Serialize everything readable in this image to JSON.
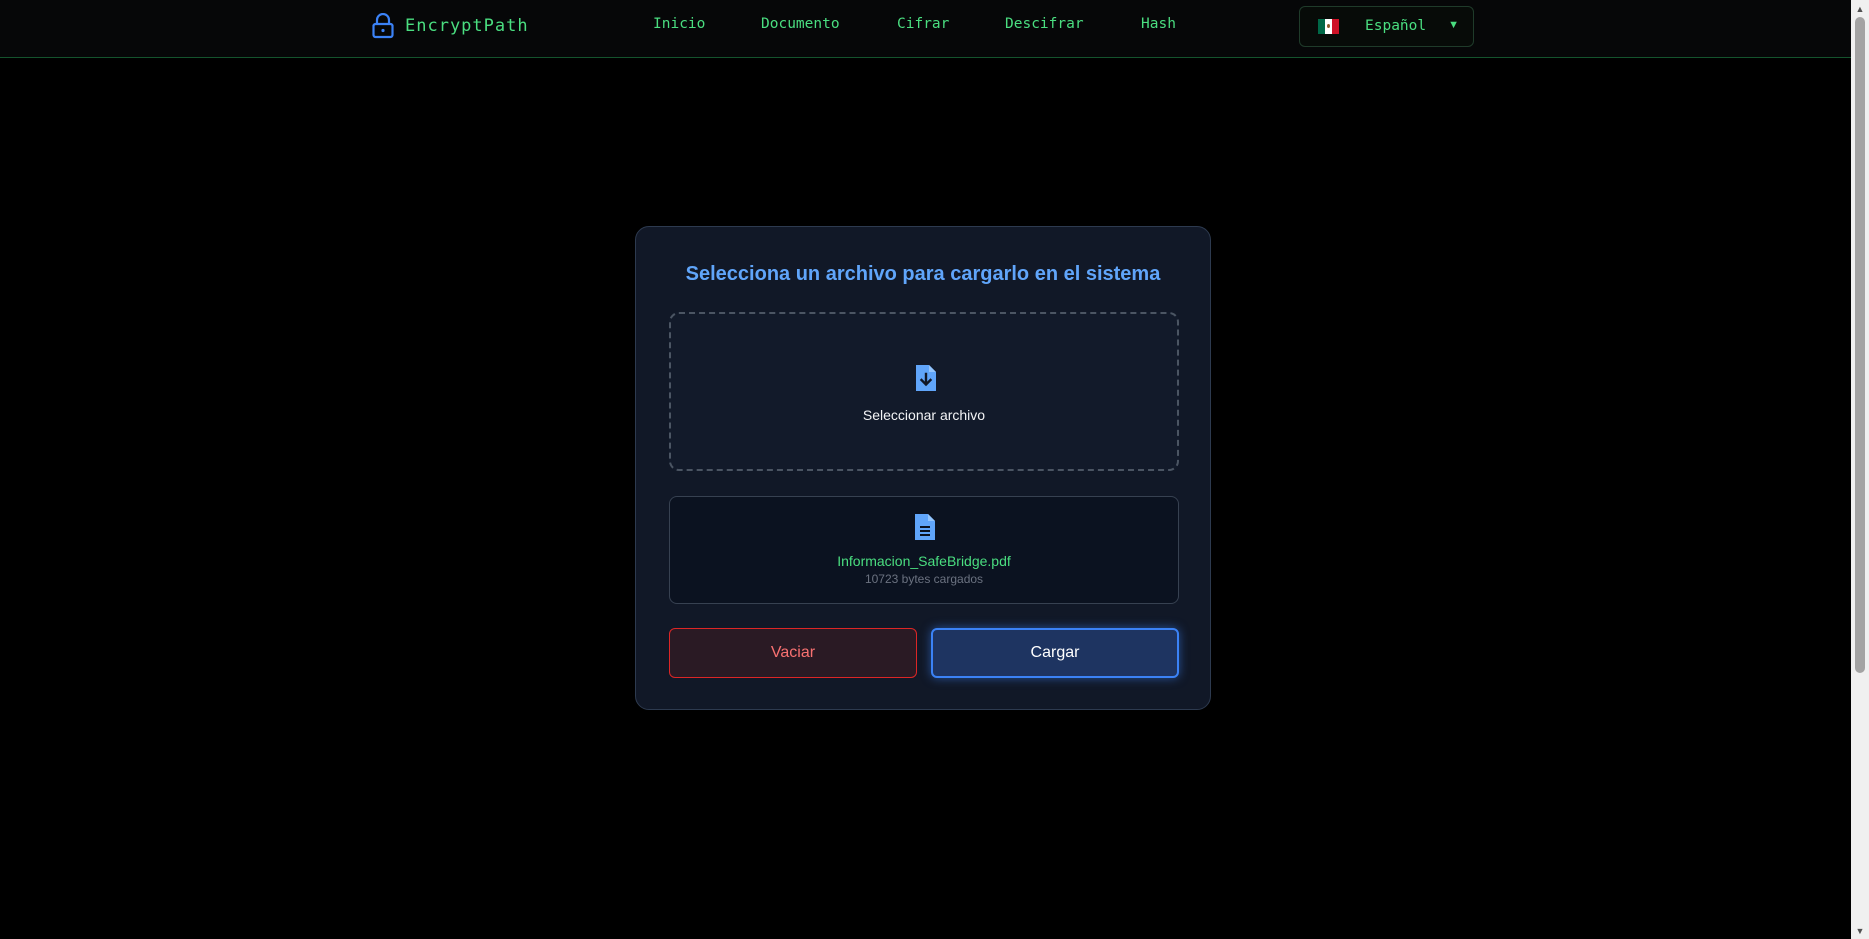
{
  "header": {
    "brand": "EncryptPath",
    "nav": [
      {
        "label": "Inicio"
      },
      {
        "label": "Documento"
      },
      {
        "label": "Cifrar"
      },
      {
        "label": "Descifrar"
      },
      {
        "label": "Hash"
      }
    ],
    "language": {
      "label": "Español",
      "flag": "mexico-flag-icon"
    }
  },
  "upload": {
    "title": "Selecciona un archivo para cargarlo en el sistema",
    "dropzone_label": "Seleccionar archivo",
    "file": {
      "name": "Informacion_SafeBridge.pdf",
      "size_text": "10723 bytes cargados"
    },
    "buttons": {
      "clear": "Vaciar",
      "upload": "Cargar"
    }
  },
  "colors": {
    "accent_green": "#4ade80",
    "accent_blue": "#60a5fa",
    "danger": "#f87171"
  },
  "icons": {
    "brand": "lock-icon",
    "dropzone": "file-download-icon",
    "file": "file-text-icon"
  }
}
